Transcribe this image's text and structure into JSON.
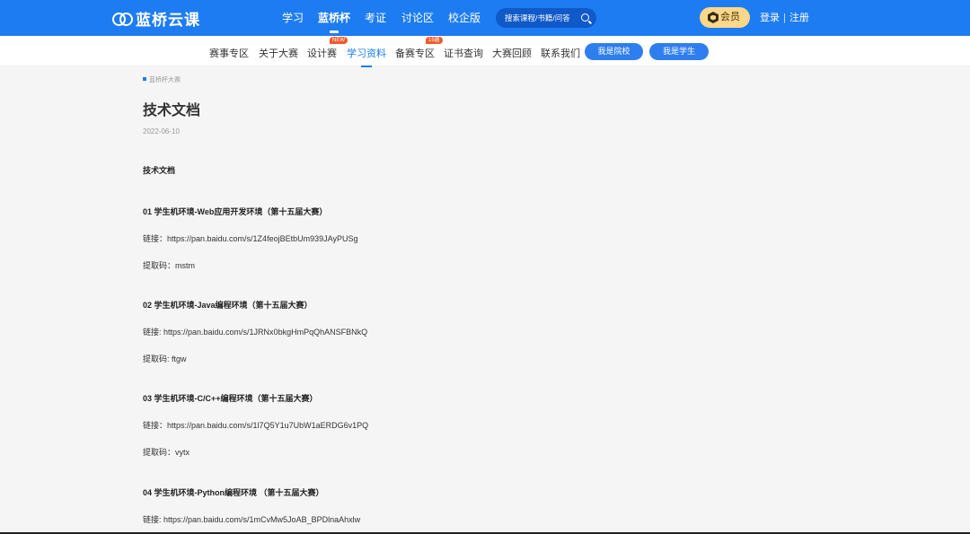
{
  "brand": {
    "name": "蓝桥云课"
  },
  "topnav": [
    {
      "label": "学习"
    },
    {
      "label": "蓝桥杯"
    },
    {
      "label": "考证"
    },
    {
      "label": "讨论区"
    },
    {
      "label": "校企版"
    }
  ],
  "search": {
    "placeholder": "搜索课程/书籍/问答"
  },
  "vip": {
    "label": "会员"
  },
  "auth": {
    "login": "登录",
    "separator": "|",
    "register": "注册"
  },
  "subnav": [
    {
      "label": "赛事专区"
    },
    {
      "label": "关于大赛"
    },
    {
      "label": "设计赛",
      "badge": "NEW"
    },
    {
      "label": "学习资料"
    },
    {
      "label": "备赛专区",
      "badge": "15届"
    },
    {
      "label": "证书查询"
    },
    {
      "label": "大赛回顾"
    },
    {
      "label": "联系我们"
    }
  ],
  "buttons": {
    "school": "我是院校",
    "student": "我是学生"
  },
  "breadcrumb": "蓝桥杯大赛",
  "article": {
    "title": "技术文档",
    "date": "2022-06-10",
    "heading": "技术文档",
    "sections": [
      {
        "title": "01  学生机环境-Web应用开发环境（第十五届大赛）",
        "link": "链接：https://pan.baidu.com/s/1Z4feojBEtbUm939JAyPUSg",
        "code": "提取码：mstm"
      },
      {
        "title": "02  学生机环境-Java编程环境（第十五届大赛）",
        "link": "链接: https://pan.baidu.com/s/1JRNx0bkgHmPqQhANSFBNkQ",
        "code": "提取码: ftgw"
      },
      {
        "title": "03  学生机环境-C/C++编程环境（第十五届大赛）",
        "link": "链接：https://pan.baidu.com/s/1l7Q5Y1u7UbW1aERDG6v1PQ",
        "code": "提取码：vytx"
      },
      {
        "title": "04  学生机环境-Python编程环境  （第十五届大赛）",
        "link": "链接: https://pan.baidu.com/s/1mCvMw5JoAB_BPDlnaAhxlw"
      }
    ]
  },
  "colors": {
    "primary": "#1e7cf2",
    "vip": "#fbd889",
    "badge": "#f25a29"
  }
}
